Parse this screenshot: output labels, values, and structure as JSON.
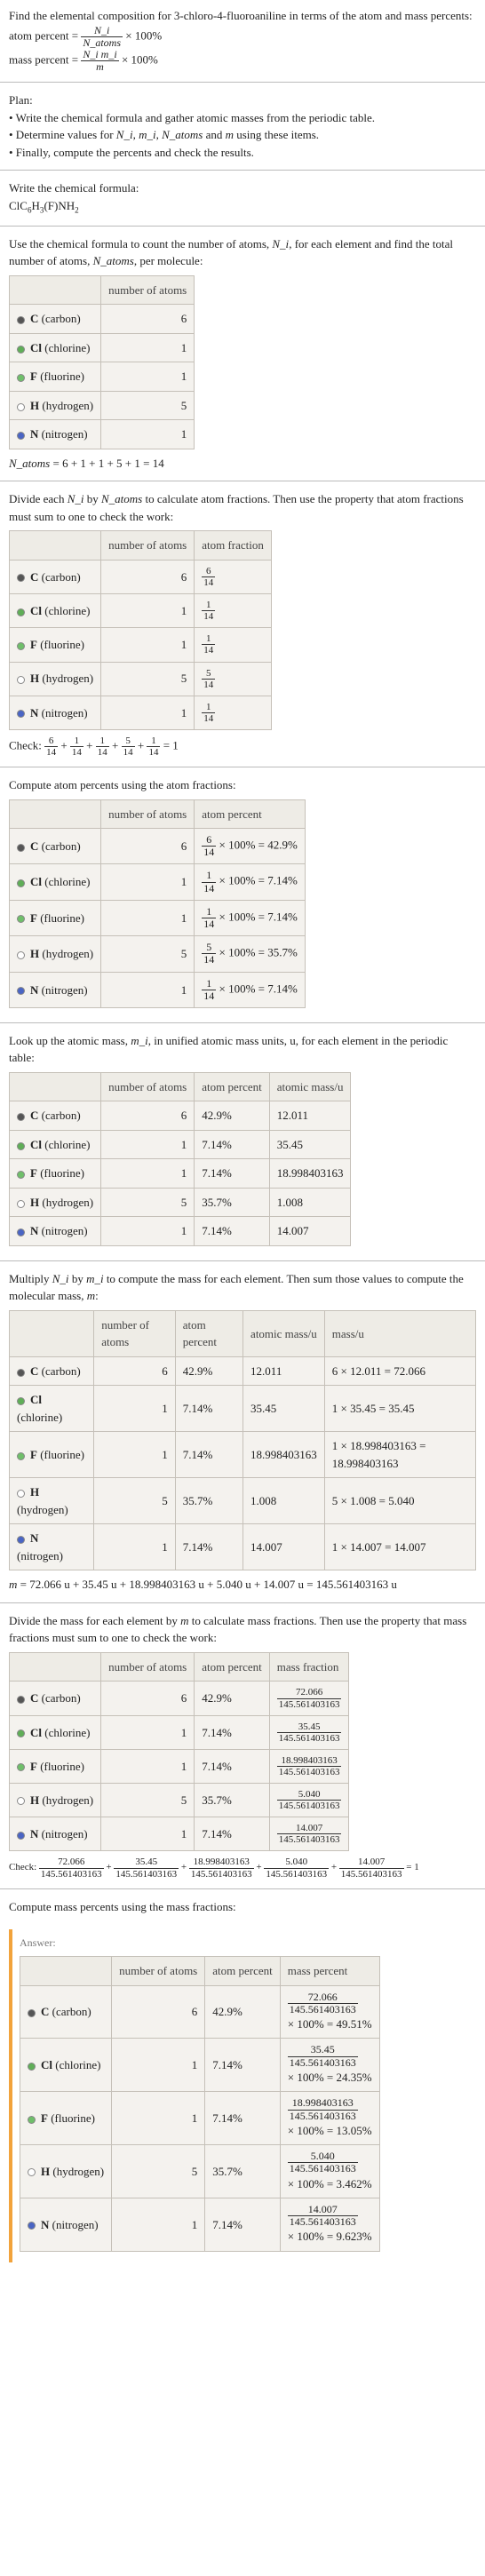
{
  "intro": "Find the elemental composition for 3-chloro-4-fluoroaniline in terms of the atom and mass percents:",
  "atom_percent_label": "atom percent =",
  "atom_percent_frac_num": "N_i",
  "atom_percent_frac_den": "N_atoms",
  "times_100": "× 100%",
  "mass_percent_label": "mass percent =",
  "mass_percent_frac_num": "N_i m_i",
  "mass_percent_frac_den": "m",
  "plan_label": "Plan:",
  "plan_1": "• Write the chemical formula and gather atomic masses from the periodic table.",
  "plan_2_a": "• Determine values for ",
  "plan_2_b": "N_i, m_i, N_atoms",
  "plan_2_c": " and ",
  "plan_2_d": "m",
  "plan_2_e": " using these items.",
  "plan_3": "• Finally, compute the percents and check the results.",
  "write_formula": "Write the chemical formula:",
  "chem_formula_plain": "ClC6H3(F)NH2",
  "use_formula_a": "Use the chemical formula to count the number of atoms, ",
  "use_formula_b": "N_i",
  "use_formula_c": ", for each element and find the total number of atoms, ",
  "use_formula_d": "N_atoms",
  "use_formula_e": ", per molecule:",
  "col_element": "",
  "col_natoms": "number of atoms",
  "col_atom_frac": "atom fraction",
  "col_atom_percent": "atom percent",
  "col_atomic_mass": "atomic mass/u",
  "col_mass_u": "mass/u",
  "col_mass_frac": "mass fraction",
  "col_mass_percent": "mass percent",
  "elements": [
    {
      "key": "carbon",
      "label": "C (carbon)",
      "n": "6"
    },
    {
      "key": "chlorine",
      "label": "Cl (chlorine)",
      "n": "1"
    },
    {
      "key": "fluorine",
      "label": "F (fluorine)",
      "n": "1"
    },
    {
      "key": "hydrogen",
      "label": "H (hydrogen)",
      "n": "5"
    },
    {
      "key": "nitrogen",
      "label": "N (nitrogen)",
      "n": "1"
    }
  ],
  "natoms_eq_a": "N_atoms",
  "natoms_eq_b": " = 6 + 1 + 1 + 5 + 1 = 14",
  "divide_each_a": "Divide each ",
  "divide_each_b": "N_i",
  "divide_each_c": " by ",
  "divide_each_d": "N_atoms",
  "divide_each_e": " to calculate atom fractions. Then use the property that atom fractions must sum to one to check the work:",
  "frac_table": [
    {
      "n": "6",
      "num": "6",
      "den": "14"
    },
    {
      "n": "1",
      "num": "1",
      "den": "14"
    },
    {
      "n": "1",
      "num": "1",
      "den": "14"
    },
    {
      "n": "5",
      "num": "5",
      "den": "14"
    },
    {
      "n": "1",
      "num": "1",
      "den": "14"
    }
  ],
  "check_label": "Check: ",
  "check_frac_eq": " = 1",
  "compute_atom_percents": "Compute atom percents using the atom fractions:",
  "percent_rows": [
    {
      "n": "6",
      "num": "6",
      "den": "14",
      "pct": "42.9%"
    },
    {
      "n": "1",
      "num": "1",
      "den": "14",
      "pct": "7.14%"
    },
    {
      "n": "1",
      "num": "1",
      "den": "14",
      "pct": "7.14%"
    },
    {
      "n": "5",
      "num": "5",
      "den": "14",
      "pct": "35.7%"
    },
    {
      "n": "1",
      "num": "1",
      "den": "14",
      "pct": "7.14%"
    }
  ],
  "lookup_mass_a": "Look up the atomic mass, ",
  "lookup_mass_b": "m_i",
  "lookup_mass_c": ", in unified atomic mass units, u, for each element in the periodic table:",
  "mass_rows": [
    {
      "n": "6",
      "pct": "42.9%",
      "mass": "12.011"
    },
    {
      "n": "1",
      "pct": "7.14%",
      "mass": "35.45"
    },
    {
      "n": "1",
      "pct": "7.14%",
      "mass": "18.998403163"
    },
    {
      "n": "5",
      "pct": "35.7%",
      "mass": "1.008"
    },
    {
      "n": "1",
      "pct": "7.14%",
      "mass": "14.007"
    }
  ],
  "multiply_text_a": "Multiply ",
  "multiply_text_b": "N_i",
  "multiply_text_c": " by ",
  "multiply_text_d": "m_i",
  "multiply_text_e": " to compute the mass for each element. Then sum those values to compute the molecular mass, ",
  "multiply_text_f": "m",
  "multiply_text_g": ":",
  "mult_rows": [
    {
      "n": "6",
      "pct": "42.9%",
      "mass": "12.011",
      "calc": "6 × 12.011 = 72.066"
    },
    {
      "n": "1",
      "pct": "7.14%",
      "mass": "35.45",
      "calc": "1 × 35.45 = 35.45"
    },
    {
      "n": "1",
      "pct": "7.14%",
      "mass": "18.998403163",
      "calc": "1 × 18.998403163 = 18.998403163"
    },
    {
      "n": "5",
      "pct": "35.7%",
      "mass": "1.008",
      "calc": "5 × 1.008 = 5.040"
    },
    {
      "n": "1",
      "pct": "7.14%",
      "mass": "14.007",
      "calc": "1 × 14.007 = 14.007"
    }
  ],
  "m_eq_a": "m",
  "m_eq_b": " = 72.066 u + 35.45 u + 18.998403163 u + 5.040 u + 14.007 u = 145.561403163 u",
  "divide_mass_a": "Divide the mass for each element by ",
  "divide_mass_b": "m",
  "divide_mass_c": " to calculate mass fractions. Then use the property that mass fractions must sum to one to check the work:",
  "mass_frac_rows": [
    {
      "n": "6",
      "pct": "42.9%",
      "num": "72.066",
      "den": "145.561403163"
    },
    {
      "n": "1",
      "pct": "7.14%",
      "num": "35.45",
      "den": "145.561403163"
    },
    {
      "n": "1",
      "pct": "7.14%",
      "num": "18.998403163",
      "den": "145.561403163"
    },
    {
      "n": "5",
      "pct": "35.7%",
      "num": "5.040",
      "den": "145.561403163"
    },
    {
      "n": "1",
      "pct": "7.14%",
      "num": "14.007",
      "den": "145.561403163"
    }
  ],
  "mass_check_nums": [
    "72.066",
    "35.45",
    "18.998403163",
    "5.040",
    "14.007"
  ],
  "mass_check_den": "145.561403163",
  "mass_check_tail": " = 1",
  "compute_mass_percents": "Compute mass percents using the mass fractions:",
  "answer_label": "Answer:",
  "final_rows": [
    {
      "n": "6",
      "pct": "42.9%",
      "num": "72.066",
      "den": "145.561403163",
      "res": "49.51%"
    },
    {
      "n": "1",
      "pct": "7.14%",
      "num": "35.45",
      "den": "145.561403163",
      "res": "24.35%"
    },
    {
      "n": "1",
      "pct": "7.14%",
      "num": "18.998403163",
      "den": "145.561403163",
      "res": "13.05%"
    },
    {
      "n": "5",
      "pct": "35.7%",
      "num": "5.040",
      "den": "145.561403163",
      "res": "3.462%"
    },
    {
      "n": "1",
      "pct": "7.14%",
      "num": "14.007",
      "den": "145.561403163",
      "res": "9.623%"
    }
  ]
}
